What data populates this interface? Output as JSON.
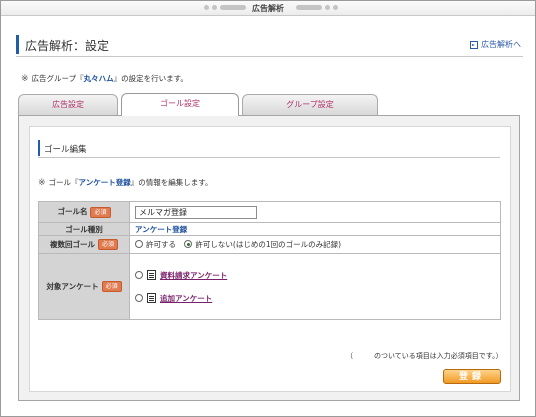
{
  "window": {
    "title": "広告解析"
  },
  "page": {
    "title": "広告解析：設定",
    "help_link": "広告解析へ"
  },
  "group_note": {
    "prefix": "広告グループ『",
    "name": "丸々ハム",
    "suffix": "』の設定を行います。"
  },
  "tabs": [
    {
      "label": "広告設定",
      "active": false
    },
    {
      "label": "ゴール設定",
      "active": true
    },
    {
      "label": "グループ設定",
      "active": false
    }
  ],
  "section": {
    "title": "ゴール編集",
    "note_prefix": "ゴール『",
    "note_name": "アンケート登録",
    "note_suffix": "』の情報を編集します。"
  },
  "form": {
    "required_badge": "必須",
    "goal_name": {
      "label": "ゴール名",
      "value": "メルマガ登録"
    },
    "goal_type": {
      "label": "ゴール種別",
      "value": "アンケート登録"
    },
    "duplicate": {
      "label": "複数回ゴール",
      "options": [
        "許可する",
        "許可しない(はじめの1回のゴールのみ記録)"
      ],
      "selected": 1
    },
    "target_survey": {
      "label": "対象アンケート",
      "options": [
        "資料請求アンケート",
        "追加アンケート"
      ]
    }
  },
  "footnote": "（　　　のついている項目は入力必須項目です。）",
  "submit_label": "登録"
}
